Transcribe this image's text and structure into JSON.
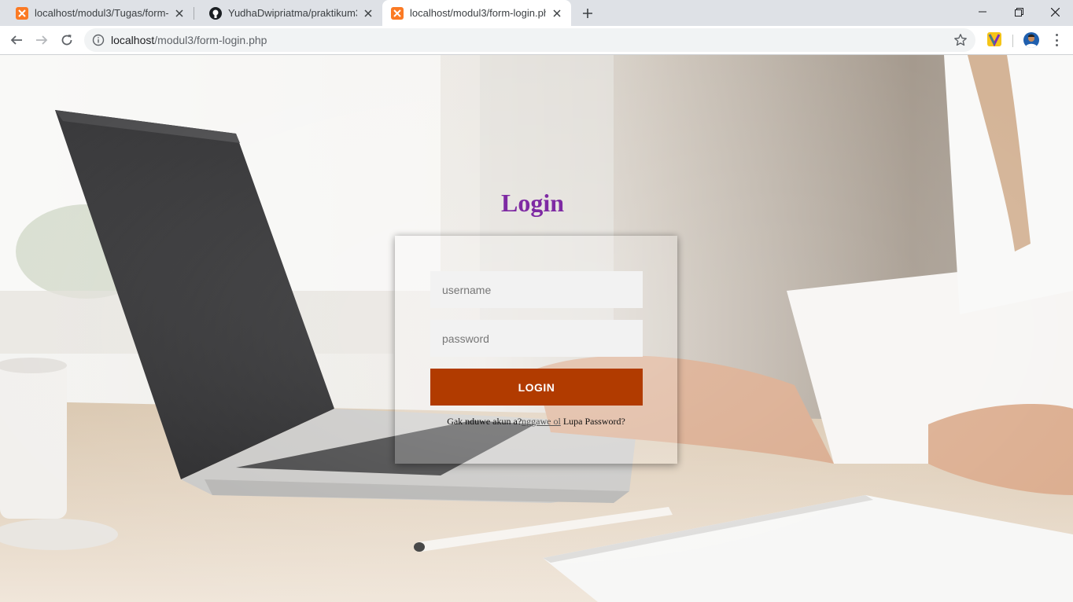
{
  "browser": {
    "tabs": [
      {
        "title": "localhost/modul3/Tugas/form-lo",
        "favicon": "xampp-icon",
        "active": false
      },
      {
        "title": "YudhaDwipriatma/praktikum3yu",
        "favicon": "github-icon",
        "active": false
      },
      {
        "title": "localhost/modul3/form-login.ph",
        "favicon": "xampp-icon",
        "active": true
      }
    ],
    "address": {
      "host": "localhost",
      "path": "/modul3/form-login.php"
    }
  },
  "page": {
    "title": "Login",
    "username_placeholder": "username",
    "password_placeholder": "password",
    "login_button": "LOGIN",
    "footer": {
      "prefix": "Gak nduwe akun a?",
      "register_link": "nggawe ol",
      "suffix": " Lupa Password?"
    }
  },
  "colors": {
    "title": "#7e2aa3",
    "button": "#b13b00",
    "field_bg": "#f2f2f2"
  }
}
